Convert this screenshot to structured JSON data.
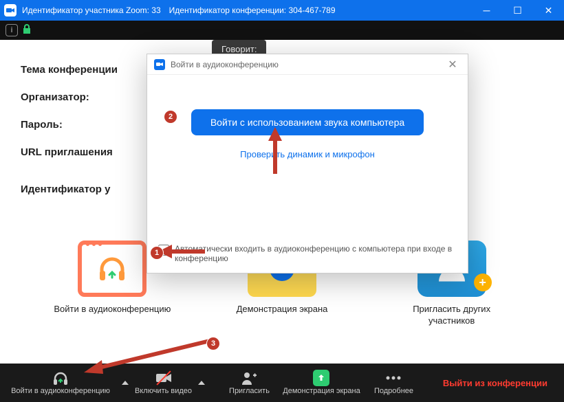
{
  "titlebar": {
    "participant_id_label": "Идентификатор участника Zoom: 33",
    "conference_id_label": "Идентификатор конференции: 304-467-789"
  },
  "speaker_tab": "Говорит:",
  "meeting_info": {
    "topic_label": "Тема конференции",
    "host_label": "Организатор:",
    "password_label": "Пароль:",
    "url_label": "URL приглашения",
    "participant_id_label": "Идентификатор у"
  },
  "tiles": {
    "audio": "Войти в аудиоконференцию",
    "share": "Демонстрация экрана",
    "invite": "Пригласить других участников"
  },
  "bottombar": {
    "join_audio": "Войти в аудиоконференцию",
    "video": "Включить видео",
    "invite": "Пригласить",
    "share": "Демонстрация экрана",
    "more": "Подробнее",
    "leave": "Выйти из конференции"
  },
  "dialog": {
    "title": "Войти в аудиоконференцию",
    "primary_button": "Войти с использованием звука компьютера",
    "test_link": "Проверить динамик и микрофон",
    "auto_join_label": "Автоматически входить в аудиоконференцию с компьютера при входе в конференцию"
  },
  "badges": {
    "b1": "1",
    "b2": "2",
    "b3": "3"
  }
}
